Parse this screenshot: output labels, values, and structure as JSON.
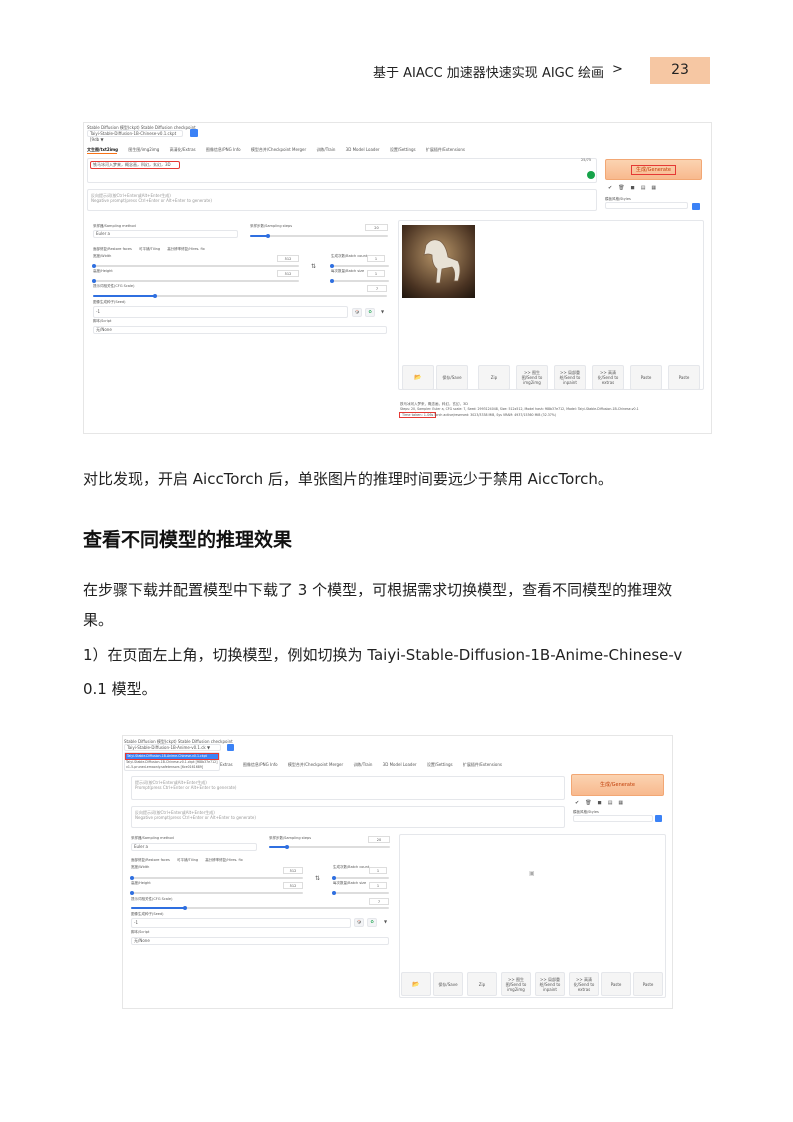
{
  "header": {
    "title": "基于 AIACC 加速器快速实现 AIGC 绘画",
    "arrow": ">",
    "page_number": "23"
  },
  "screenshot1": {
    "model_label": "Stable Diffusion 模型(ckpt) Stable Diffusion checkpoint",
    "model_value": "Taiyi-Stable-Diffusion-1B-Chinese-v0.1.ckpt [9db ▼",
    "tabs": [
      "文生图/txt2img",
      "图生图/img2img",
      "高清化/Extras",
      "图像信息/PNG Info",
      "模型合并/Checkpoint Merger",
      "训练/Train",
      "3D Model Loader",
      "设置/Settings",
      "扩展插件/Extensions"
    ],
    "prompt": "铁马冰河入梦来，概念画，科幻，玄幻，3D",
    "token_count": "25/75",
    "negative_placeholder": "反向提示词(按Ctrl+Enter或Alt+Enter生成)\nNegative prompt(press Ctrl+Enter or Alt+Enter to generate)",
    "generate_label": "生成/Generate",
    "styles_label": "模板风格/Styles",
    "sampler_label": "采样器/Sampling method",
    "sampler_value": "Euler a",
    "steps_label": "采样步数/Sampling steps",
    "steps_value": "20",
    "restore_faces": "面部修复/Restore faces",
    "tiling": "可平铺/Tiling",
    "hires": "高分辨率修复/Hires. fix",
    "width_label": "宽度/Width",
    "width_value": "512",
    "height_label": "高度/Height",
    "height_value": "512",
    "batch_count_label": "生成次数/Batch count",
    "batch_count_value": "1",
    "batch_size_label": "每次数量/Batch size",
    "batch_size_value": "1",
    "cfg_label": "提示词相关性(CFG Scale)",
    "cfg_value": "7",
    "seed_label": "图像生成种子(Seed)",
    "seed_value": "-1",
    "script_label": "脚本/Script",
    "script_value": "无/None",
    "buttons": [
      "保存/Save",
      "Zip",
      ">> 图生图/Send to img2img",
      ">> 局部重绘/Send to inpaint",
      ">> 高清化/Send to extras",
      "Paste",
      "Paste"
    ],
    "info_line1": "铁马冰河入梦来，概念画，科幻，玄幻，3D",
    "info_line2": "Steps: 20, Sampler: Euler a, CFG scale: 7, Seed: 2993124048, Size: 512x512, Model hash: f68b37e712, Model: Taiyi-Stable-Diffusion-1B-Chinese-v0.1",
    "time_taken": "Time taken: 1.06s",
    "info_line3": "Torch active/reserved: 3023/3338 MiB, Sys VRAM: 4937/15360 MiB (32.37%)"
  },
  "para1": "对比发现，开启 AiccTorch 后，单张图片的推理时间要远少于禁用 AiccTorch。",
  "heading": "查看不同模型的推理效果",
  "para2_line1": "在步骤下载并配置模型中下载了 3 个模型，可根据需求切换模型，查看不同模型的推理效",
  "para2_line2": "果。",
  "para3_line1": "1）在页面左上角，切换模型，例如切换为 Taiyi-Stable-Diffusion-1B-Anime-Chinese-v",
  "para3_line2": "0.1 模型。",
  "screenshot2": {
    "model_label": "Stable Diffusion 模型(ckpt) Stable Diffusion checkpoint",
    "model_value": "Taiyi-Stable-Diffusion-1B-Anime-v0.1.ck ▼",
    "dropdown_items": [
      "Taiyi-Stable-Diffusion-1B-Anime-Chinese-v0.1.ckpt",
      "Taiyi-Stable-Diffusion-1B-Chinese-v0.1.ckpt [f68b37e712]",
      "v1-5-pruned-emaonly.safetensors [6ce0161689]"
    ],
    "tabs": [
      "文生图/txt2img",
      "图生图/img2img",
      "高清化/Extras",
      "图像信息/PNG Info",
      "模型合并/Checkpoint Merger",
      "训练/Train",
      "3D Model Loader",
      "设置/Settings",
      "扩展插件/Extensions"
    ],
    "prompt_placeholder": "提示词(按Ctrl+Enter或Alt+Enter生成)\nPrompt(press Ctrl+Enter or Alt+Enter to generate)",
    "negative_placeholder": "反向提示词(按Ctrl+Enter或Alt+Enter生成)\nNegative prompt(press Ctrl+Enter or Alt+Enter to generate)",
    "generate_label": "生成/Generate",
    "styles_label": "模板风格/Styles",
    "sampler_label": "采样器/Sampling method",
    "sampler_value": "Euler a",
    "steps_label": "采样步数/Sampling steps",
    "steps_value": "20",
    "restore_faces": "面部修复/Restore faces",
    "tiling": "可平铺/Tiling",
    "hires": "高分辨率修复/Hires. fix",
    "width_label": "宽度/Width",
    "width_value": "512",
    "height_label": "高度/Height",
    "height_value": "512",
    "batch_count_label": "生成次数/Batch count",
    "batch_count_value": "1",
    "batch_size_label": "每次数量/Batch size",
    "batch_size_value": "1",
    "cfg_label": "提示词相关性(CFG Scale)",
    "cfg_value": "7",
    "seed_label": "图像生成种子(Seed)",
    "seed_value": "-1",
    "script_label": "脚本/Script",
    "script_value": "无/None",
    "buttons": [
      "保存/Save",
      "Zip",
      ">> 图生图/Send to img2img",
      ">> 局部重绘/Send to inpaint",
      ">> 高清化/Send to extras",
      "Paste",
      "Paste"
    ]
  }
}
